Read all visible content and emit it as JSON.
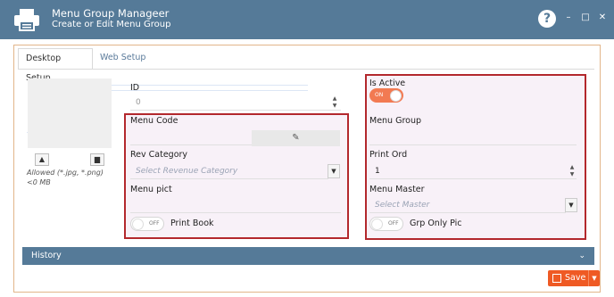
{
  "window": {
    "title": "Menu Group Manageer",
    "subtitle": "Create or Edit Menu Group",
    "help": "?",
    "minimize": "–",
    "maximize": "□",
    "close": "✕"
  },
  "tabs": {
    "desktop": "Desktop Setup",
    "web": "Web Setup"
  },
  "image": {
    "allowed": "Allowed (*.jpg, *.png) <0 MB",
    "upload_icon": "upload-icon",
    "delete_icon": "trash-icon"
  },
  "form": {
    "id_label": "ID",
    "id_value": "0",
    "menu_code_label": "Menu Code",
    "menu_code_value": "",
    "rev_category_label": "Rev Category",
    "rev_category_placeholder": "Select Revenue Category",
    "menu_pict_label": "Menu pict",
    "menu_pict_value": "",
    "print_book_toggle": "OFF",
    "print_book_label": "Print Book",
    "is_active_label": "Is Active",
    "is_active_toggle": "ON",
    "menu_group_label": "Menu Group",
    "menu_group_value": "",
    "print_ord_label": "Print Ord",
    "print_ord_value": "1",
    "menu_master_label": "Menu Master",
    "menu_master_placeholder": "Select Master",
    "grp_only_pic_toggle": "OFF",
    "grp_only_pic_label": "Grp Only Pic"
  },
  "history": {
    "label": "History",
    "chevron": "⌄"
  },
  "actions": {
    "save": "Save",
    "save_caret": "▼"
  },
  "colors": {
    "titlebar": "#557a98",
    "accent": "#ef5a24",
    "highlight_border": "#b3282d",
    "toggle_on": "#f27a52"
  }
}
